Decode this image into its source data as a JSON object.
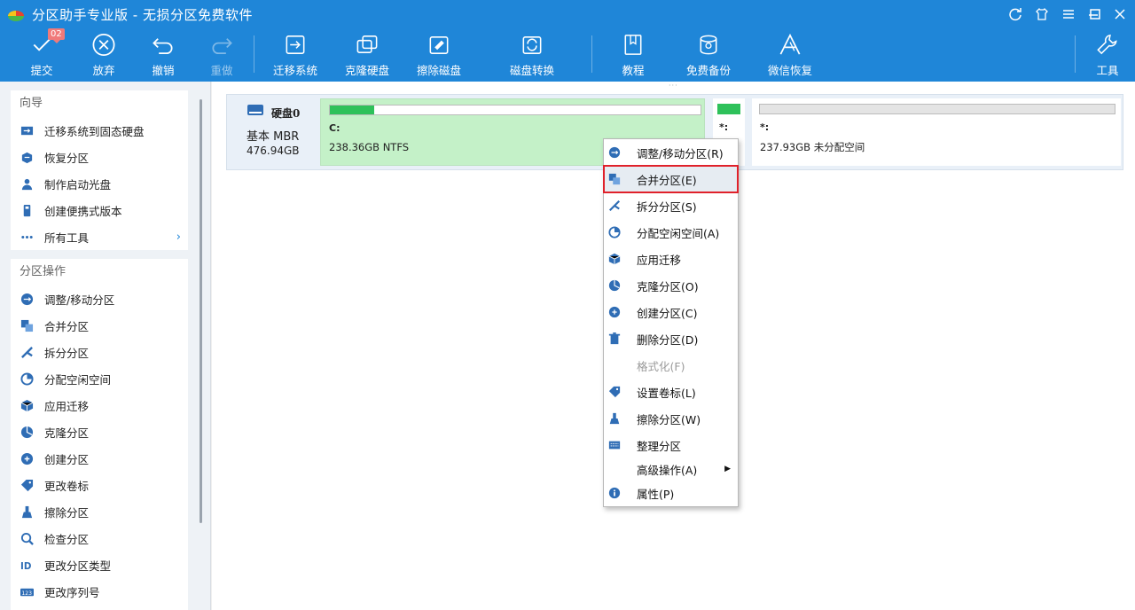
{
  "app": {
    "title": "分区助手专业版 - 无损分区免费软件"
  },
  "colors": {
    "brand": "#1f86d8",
    "partition_used": "#2ec15a",
    "partition_bg": "#c4f1c8",
    "highlight": "#e0212a"
  },
  "toolbar": {
    "commit": {
      "label": "提交",
      "badge": "02"
    },
    "discard": {
      "label": "放弃"
    },
    "undo": {
      "label": "撤销"
    },
    "redo": {
      "label": "重做"
    },
    "migrate": {
      "label": "迁移系统"
    },
    "clone_disk": {
      "label": "克隆硬盘"
    },
    "wipe_disk": {
      "label": "擦除磁盘"
    },
    "convert_disk": {
      "label": "磁盘转换"
    },
    "tutorial": {
      "label": "教程"
    },
    "backup": {
      "label": "免费备份"
    },
    "wechat": {
      "label": "微信恢复"
    },
    "tools": {
      "label": "工具"
    }
  },
  "sidebar": {
    "wizard": {
      "title": "向导",
      "items": [
        {
          "label": "迁移系统到固态硬盘",
          "icon": "migrate-icon"
        },
        {
          "label": "恢复分区",
          "icon": "recover-icon"
        },
        {
          "label": "制作启动光盘",
          "icon": "bootdisk-icon"
        },
        {
          "label": "创建便携式版本",
          "icon": "portable-icon"
        },
        {
          "label": "所有工具",
          "icon": "more-icon"
        }
      ]
    },
    "ops": {
      "title": "分区操作",
      "items": [
        {
          "label": "调整/移动分区",
          "icon": "resize-icon"
        },
        {
          "label": "合并分区",
          "icon": "merge-icon"
        },
        {
          "label": "拆分分区",
          "icon": "split-icon"
        },
        {
          "label": "分配空闲空间",
          "icon": "allocate-icon"
        },
        {
          "label": "应用迁移",
          "icon": "app-migrate-icon"
        },
        {
          "label": "克隆分区",
          "icon": "clone-icon"
        },
        {
          "label": "创建分区",
          "icon": "create-icon"
        },
        {
          "label": "更改卷标",
          "icon": "tag-icon"
        },
        {
          "label": "擦除分区",
          "icon": "wipe-icon"
        },
        {
          "label": "检查分区",
          "icon": "check-icon"
        },
        {
          "label": "更改分区类型",
          "icon": "id-icon"
        },
        {
          "label": "更改序列号",
          "icon": "serial-icon"
        }
      ]
    }
  },
  "disk": {
    "name": "硬盘0",
    "type": "基本 MBR",
    "size": "476.94GB",
    "partitions": [
      {
        "label": "C:",
        "detail": "238.36GB NTFS",
        "used_fraction": 0.12
      },
      {
        "label": "*:",
        "detail": ""
      },
      {
        "label": "*:",
        "detail": "237.93GB 未分配空间",
        "used_fraction": 0
      }
    ]
  },
  "context_menu": {
    "items": [
      {
        "label": "调整/移动分区(R)",
        "icon": "resize-icon"
      },
      {
        "label": "合并分区(E)",
        "icon": "merge-icon",
        "highlighted": true
      },
      {
        "label": "拆分分区(S)",
        "icon": "split-icon"
      },
      {
        "label": "分配空闲空间(A)",
        "icon": "allocate-icon"
      },
      {
        "label": "应用迁移",
        "icon": "app-migrate-icon"
      },
      {
        "label": "克隆分区(O)",
        "icon": "clone-icon"
      },
      {
        "label": "创建分区(C)",
        "icon": "create-icon"
      },
      {
        "label": "删除分区(D)",
        "icon": "delete-icon"
      },
      {
        "label": "格式化(F)",
        "icon": "",
        "disabled": true
      },
      {
        "label": "设置卷标(L)",
        "icon": "tag-icon"
      },
      {
        "label": "擦除分区(W)",
        "icon": "wipe-icon"
      },
      {
        "label": "整理分区",
        "icon": "defrag-icon"
      },
      {
        "label": "高级操作(A)",
        "icon": "",
        "submenu": true
      },
      {
        "label": "属性(P)",
        "icon": "info-icon"
      }
    ]
  }
}
